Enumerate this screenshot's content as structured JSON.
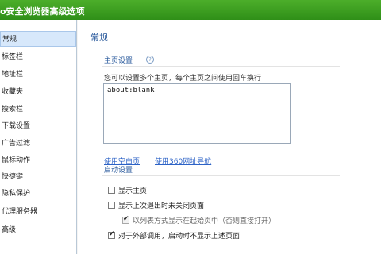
{
  "window": {
    "title": "o安全浏览器高级选项"
  },
  "sidebar": {
    "items": [
      {
        "label": "常规",
        "active": true
      },
      {
        "label": "标签栏"
      },
      {
        "label": "地址栏"
      },
      {
        "label": "收藏夹"
      },
      {
        "label": "搜索栏"
      },
      {
        "label": "下载设置"
      },
      {
        "label": "广告过滤"
      },
      {
        "label": "鼠标动作"
      },
      {
        "label": "快捷键"
      },
      {
        "label": "隐私保护"
      },
      {
        "label": "代理服务器"
      },
      {
        "label": "高级"
      }
    ]
  },
  "main": {
    "section_title": "常规",
    "homepage": {
      "group_label": "主页设置",
      "help_icon": "help-icon",
      "description": "您可以设置多个主页，每个主页之间使用回车换行",
      "value": "about:blank",
      "link_blank": "使用空白页",
      "link_360": "使用360网址导航"
    },
    "startup": {
      "group_label": "启动设置",
      "options": [
        {
          "label": "显示主页",
          "checked": false
        },
        {
          "label": "显示上次退出时未关闭页面",
          "checked": false
        },
        {
          "label": "以列表方式显示在起始页中（否则直接打开）",
          "checked": true,
          "disabled": true
        },
        {
          "label": "对于外部调用，启动时不显示上述页面",
          "checked": true
        }
      ]
    }
  }
}
